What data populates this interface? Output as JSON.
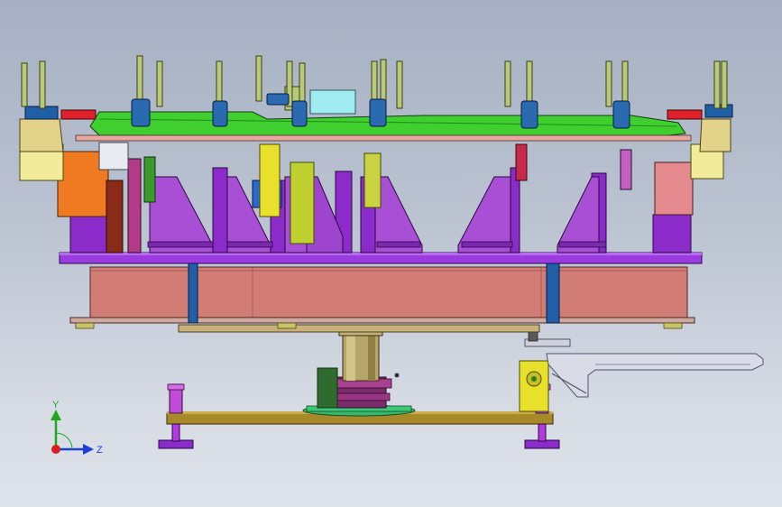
{
  "viewport": {
    "background_top": "#a6b0c2",
    "background_bottom": "#dfe3ea"
  },
  "triad": {
    "y_label": "Y",
    "z_label": "Z",
    "y_color": "#1fa81f",
    "z_color": "#1c3fd6",
    "x_color": "#d81e1e"
  },
  "model": {
    "colors": {
      "base_plate": "#a7892a",
      "table_frame": "#d17c74",
      "top_plate": "#9a3ce0",
      "riser": "#8b2bc9",
      "gusset": "#a84fd6",
      "part_panel": "#3fcf2f",
      "pole": "#b8c97a",
      "yellow_block": "#e8e02a",
      "orange_block": "#f07a22",
      "column": "#b7a56a",
      "clamp_blue": "#1f5fa8"
    }
  }
}
